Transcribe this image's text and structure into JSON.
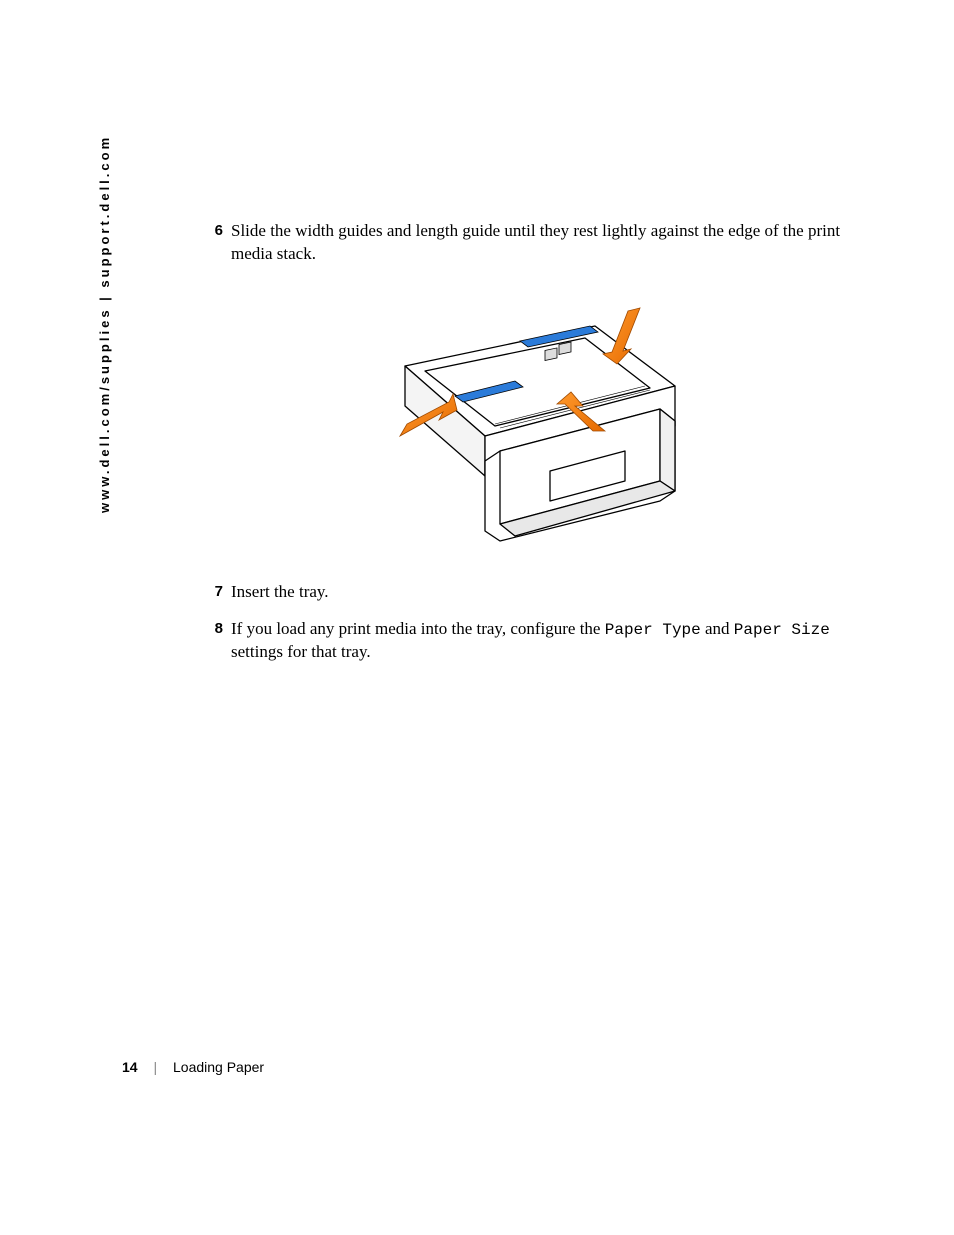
{
  "side_url": "www.dell.com/supplies | support.dell.com",
  "steps": {
    "s6": {
      "num": "6",
      "text": "Slide the width guides and length guide until they rest lightly against the edge of the print media stack."
    },
    "s7": {
      "num": "7",
      "text": "Insert the tray."
    },
    "s8": {
      "num": "8",
      "pre": "If you load any print media into the tray, configure the ",
      "mono1": "Paper Type",
      "mid": " and ",
      "mono2": "Paper Size",
      "post": " settings for that tray."
    }
  },
  "footer": {
    "page": "14",
    "section": "Loading Paper"
  }
}
